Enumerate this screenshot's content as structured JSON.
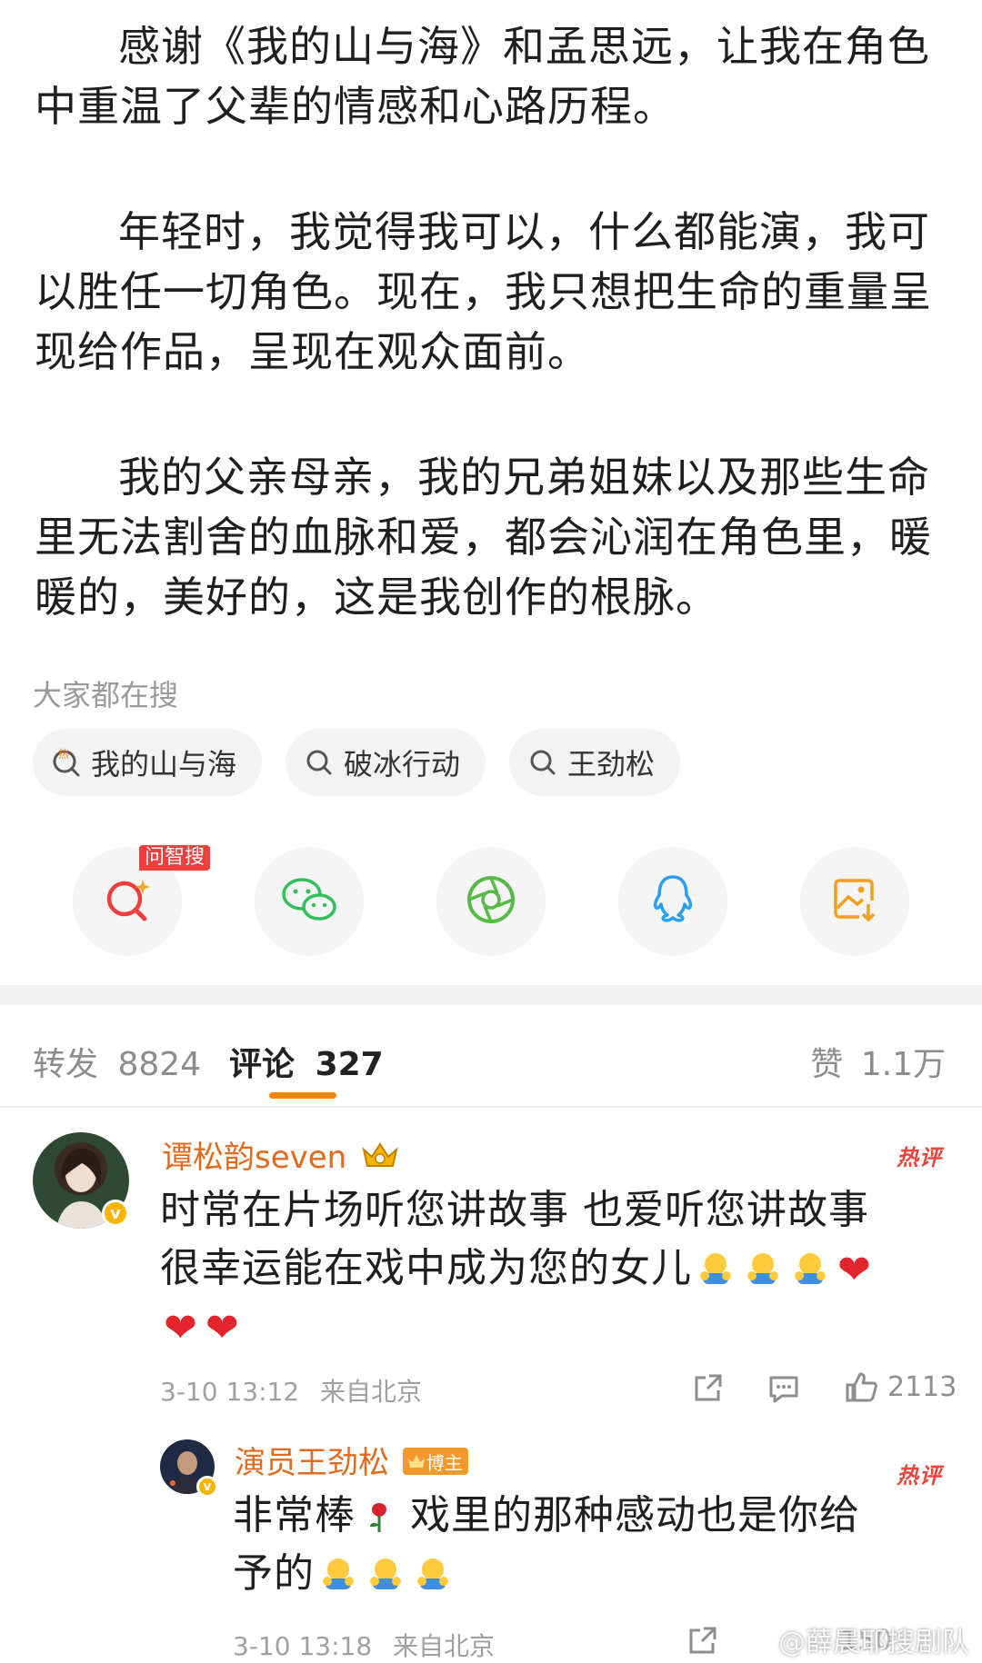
{
  "post": {
    "paragraphs": [
      "感谢《我的山与海》和孟思远，让我在角色中重温了父辈的情感和心路历程。",
      "年轻时，我觉得我可以，什么都能演，我可以胜任一切角色。现在，我只想把生命的重量呈现给作品，呈现在观众面前。",
      "我的父亲母亲，我的兄弟姐妹以及那些生命里无法割舍的血脉和爱，都会沁润在角色里，暖暖的，美好的，这是我创作的根脉。"
    ]
  },
  "hot_search": {
    "label": "大家都在搜",
    "chips": [
      {
        "label": "我的山与海",
        "icon": "hot-search-icon",
        "icon_text": "热"
      },
      {
        "label": "破冰行动",
        "icon": "search-icon"
      },
      {
        "label": "王劲松",
        "icon": "search-icon"
      }
    ]
  },
  "share": {
    "badge": "问智搜",
    "buttons": [
      "ai-search-icon",
      "wechat-icon",
      "moments-icon",
      "qq-icon",
      "save-image-icon"
    ]
  },
  "tabs": {
    "repost_label": "转发",
    "repost_count": "8824",
    "comment_label": "评论",
    "comment_count": "327",
    "like_label": "赞",
    "like_count": "1.1万"
  },
  "comments": [
    {
      "user": "谭松韵seven",
      "hot_tag": "热评",
      "text_line1": "时常在片场听您讲故事 也爱听您讲故事",
      "text_line2": "很幸运能在戏中成为您的女儿",
      "time": "3-10 13:12",
      "location": "来自北京",
      "likes": "2113"
    },
    {
      "user": "演员王劲松",
      "owner_tag": "博主",
      "hot_tag": "热评",
      "text_line1a": "非常棒",
      "text_line1b": "戏里的那种感动也是你给",
      "text_line2": "予的",
      "time": "3-10 13:18",
      "location": "来自北京",
      "likes": "150"
    }
  ],
  "watermark": "@薛晨耶搜剧队",
  "colors": {
    "accent": "#ff8200",
    "username": "#e06b1f",
    "hot": "#e8453c"
  }
}
